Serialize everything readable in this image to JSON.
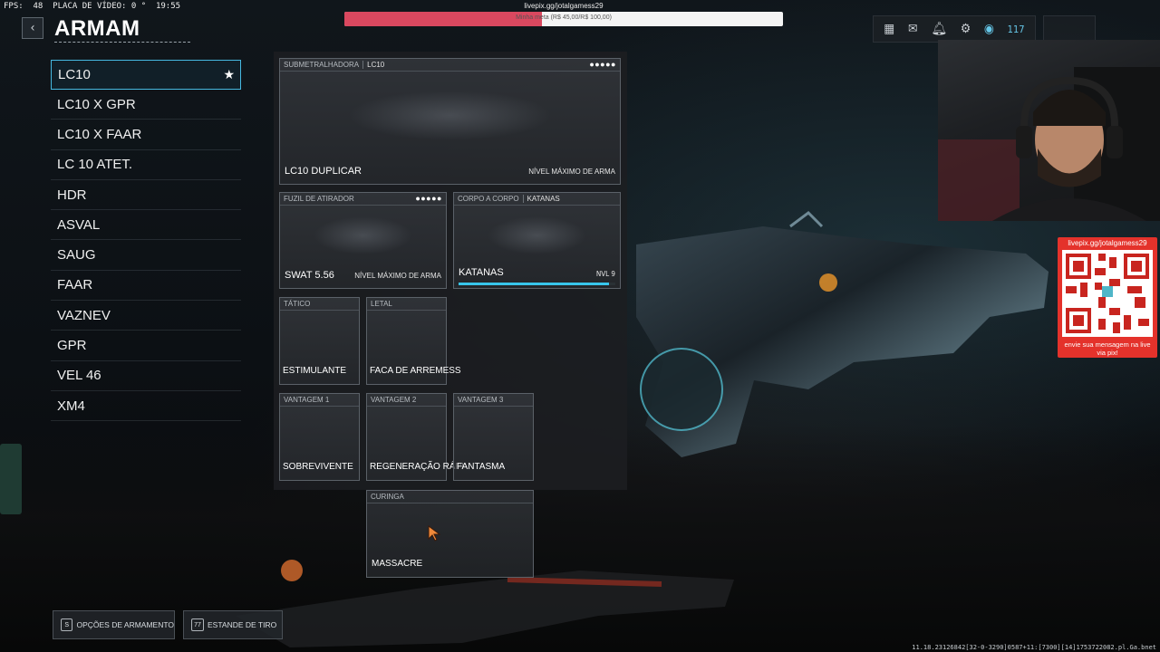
{
  "hud": {
    "fps_text": "FPS:  48  PLACA DE VÍDEO: 0 °  19:55"
  },
  "stream": {
    "url": "livepix.gg/jotalgamess29",
    "meta_text": "Minha meta (R$ 45,00/R$ 100,00)",
    "meta_progress": 0.45
  },
  "header": {
    "title": "ARMAM",
    "back_icon": "chevron-left-icon"
  },
  "top_icons": {
    "level": "117",
    "icons": [
      "grid-icon",
      "mail-icon",
      "bell-icon",
      "gear-icon",
      "rank-badge-icon"
    ]
  },
  "weapons": [
    {
      "label": "LC10",
      "selected": true,
      "favorite": true
    },
    {
      "label": "LC10 X GPR"
    },
    {
      "label": "LC10 X FAAR"
    },
    {
      "label": "LC 10 ATET."
    },
    {
      "label": "HDR"
    },
    {
      "label": "ASVAL"
    },
    {
      "label": "SAUG"
    },
    {
      "label": "FAAR"
    },
    {
      "label": "VAZNEV"
    },
    {
      "label": "GPR"
    },
    {
      "label": "VEL 46"
    },
    {
      "label": "XM4"
    }
  ],
  "loadout": {
    "primary": {
      "category": "SUBMETRALHADORA",
      "weapon": "LC10",
      "dots": "●●●●●",
      "name": "LC10 DUPLICAR",
      "status": "NÍVEL MÁXIMO DE ARMA"
    },
    "secondary": {
      "category": "FUZIL DE ATIRADOR",
      "dots": "●●●●●",
      "name": "SWAT 5.56",
      "status": "NÍVEL MÁXIMO DE ARMA"
    },
    "melee": {
      "category": "CORPO A CORPO",
      "weapon": "KATANAS",
      "name": "KATANAS",
      "level": "NVL 9",
      "progress": 0.96
    },
    "tactical": {
      "category": "TÁTICO",
      "name": "ESTIMULANTE"
    },
    "lethal": {
      "category": "LETAL",
      "name": "FACA DE ARREMESS"
    },
    "perk1": {
      "category": "VANTAGEM 1",
      "name": "SOBREVIVENTE"
    },
    "perk2": {
      "category": "VANTAGEM 2",
      "name": "REGENERAÇÃO RÁPI"
    },
    "perk3": {
      "category": "VANTAGEM 3",
      "name": "FANTASMA"
    },
    "wildcard": {
      "category": "CURINGA",
      "name": "MASSACRE"
    }
  },
  "footer": {
    "options_key": "S",
    "options_label": "OPÇÕES DE ARMAMENTO",
    "range_key": "77",
    "range_label": "ESTANDE DE TIRO",
    "build_info": "11.18.23126842[32-0-3290]0587+11:[7300][14]1753722082.pl.Ga.bnet"
  },
  "overlay": {
    "qr_url": "livepix.gg/jotalgamess29",
    "qr_caption": "envie sua mensagem na live via pix!"
  },
  "colors": {
    "accent": "#46b8e0",
    "xp_bar": "#38c6ec",
    "meta_fill": "#d9485f",
    "qr_bg": "#e4322b"
  }
}
